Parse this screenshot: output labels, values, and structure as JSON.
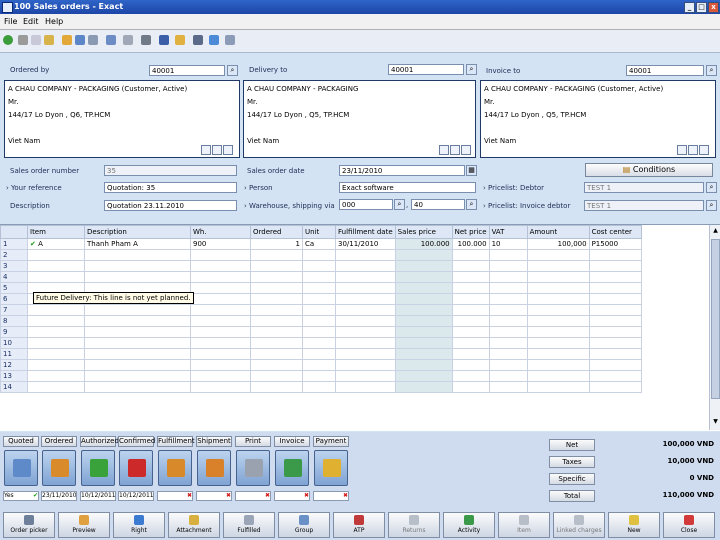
{
  "window": {
    "title": "100 Sales orders - Exact",
    "controls": [
      "_",
      "□",
      "x"
    ]
  },
  "menu": [
    "File",
    "Edit",
    "Help"
  ],
  "header": {
    "ordered_by": {
      "label": "Ordered by",
      "value": "40001"
    },
    "delivery_to": {
      "label": "Delivery to",
      "value": "40001"
    },
    "invoice_to": {
      "label": "Invoice to",
      "value": "40001"
    },
    "addresses": [
      [
        "A CHAU COMPANY - PACKAGING (Customer, Active)",
        "Mr.",
        "144/17 Lo Dyon , Q6, TP.HCM",
        "",
        "Viet Nam"
      ],
      [
        "A CHAU COMPANY - PACKAGING",
        "Mr.",
        "144/17 Lo Dyon , Q5, TP.HCM",
        "",
        "Viet Nam"
      ],
      [
        "A CHAU COMPANY - PACKAGING (Customer, Active)",
        "Mr.",
        "144/17 Lo Dyon , Q5, TP.HCM",
        "",
        "Viet Nam"
      ]
    ],
    "sales_order_number": {
      "label": "Sales order number",
      "value": "35"
    },
    "your_reference": {
      "label": "Your reference",
      "value": "Quotation: 35"
    },
    "description": {
      "label": "Description",
      "value": "Quotation 23.11.2010"
    },
    "sales_order_date": {
      "label": "Sales order date",
      "value": "23/11/2010"
    },
    "person": {
      "label": "Person",
      "value": "Exact software"
    },
    "warehouse": {
      "label": "Warehouse, shipping via",
      "value1": "000",
      "value2": "40"
    },
    "conditions_button": "Conditions",
    "pricelist_debtor": {
      "label": "Pricelist: Debtor",
      "value": "TEST 1"
    },
    "pricelist_invoice": {
      "label": "Pricelist: Invoice debtor",
      "value": "TEST 1"
    }
  },
  "lines": {
    "columns": [
      "",
      "Item",
      "Description",
      "Wh.",
      "Ordered",
      "Unit",
      "Fulfillment date",
      "Sales price",
      "Net price",
      "VAT",
      "Amount",
      "Cost center"
    ],
    "rows": [
      [
        "1",
        "A",
        "Thanh Pham A",
        "900",
        "1",
        "Ca",
        "30/11/2010",
        "100.000",
        "100.000",
        "10",
        "100,000",
        "P15000"
      ]
    ],
    "row_numbers": [
      "2",
      "3",
      "4",
      "5",
      "6",
      "7",
      "8",
      "9",
      "10",
      "11",
      "12",
      "13",
      "14"
    ],
    "tooltip": "Future Delivery: This line is not yet planned."
  },
  "workflow": {
    "buttons": [
      "Quoted",
      "Ordered",
      "Authorized",
      "Confirmed",
      "Fulfillment",
      "Shipment",
      "Print",
      "Invoice",
      "Payment"
    ],
    "statuses": [
      {
        "text": "Yes",
        "state": "ok"
      },
      {
        "text": "23/11/2010",
        "state": "ok"
      },
      {
        "text": "10/12/2011",
        "state": "ok"
      },
      {
        "text": "10/12/2011",
        "state": "ok"
      },
      {
        "text": "",
        "state": "no"
      },
      {
        "text": "",
        "state": "no"
      },
      {
        "text": "",
        "state": "no"
      },
      {
        "text": "",
        "state": "no"
      },
      {
        "text": "",
        "state": "no"
      }
    ]
  },
  "totals": [
    {
      "label": "Net",
      "value": "100,000 VND"
    },
    {
      "label": "Taxes",
      "value": "10,000 VND"
    },
    {
      "label": "Specific",
      "value": "0 VND"
    },
    {
      "label": "Total",
      "value": "110,000 VND"
    }
  ],
  "actions": [
    {
      "label": "Order picker",
      "enabled": true
    },
    {
      "label": "Preview",
      "enabled": true
    },
    {
      "label": "Right",
      "enabled": true
    },
    {
      "label": "Attachment",
      "enabled": true
    },
    {
      "label": "Fulfilled",
      "enabled": true
    },
    {
      "label": "Group",
      "enabled": true
    },
    {
      "label": "ATP",
      "enabled": true
    },
    {
      "label": "Returns",
      "enabled": false
    },
    {
      "label": "Activity",
      "enabled": true
    },
    {
      "label": "Item",
      "enabled": false
    },
    {
      "label": "Linked charges",
      "enabled": false
    },
    {
      "label": "New",
      "enabled": true
    },
    {
      "label": "Close",
      "enabled": true
    }
  ],
  "colors": {
    "titlebar": "#1d46a6",
    "ok": "#1a9c1a",
    "error": "#d21818",
    "panel": "#d4e3f4"
  }
}
